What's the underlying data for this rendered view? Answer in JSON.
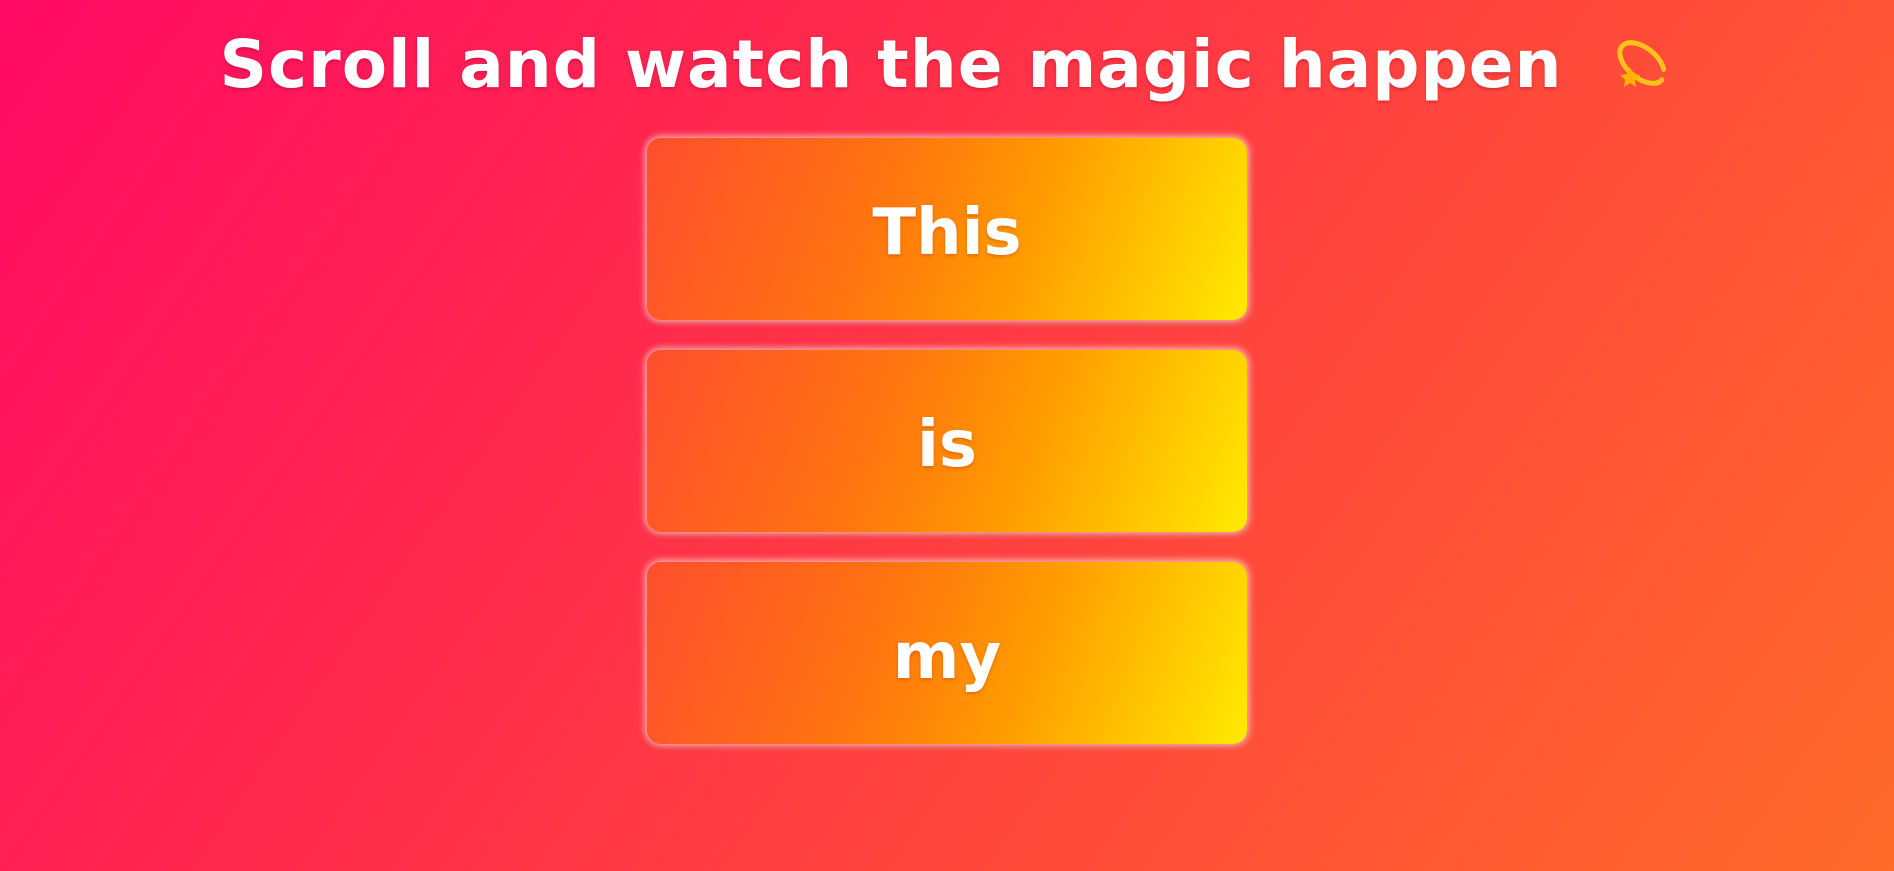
{
  "page": {
    "title": "Scroll and watch the magic happen",
    "title_icon": "dizzy-star-icon"
  },
  "cards": [
    {
      "label": "This"
    },
    {
      "label": "is"
    },
    {
      "label": "my"
    }
  ],
  "colors": {
    "background_start": "#ff0a64",
    "background_end": "#ff6b2a",
    "card_start": "#ff4e2e",
    "card_end": "#ffea00",
    "text": "#ffffff"
  }
}
